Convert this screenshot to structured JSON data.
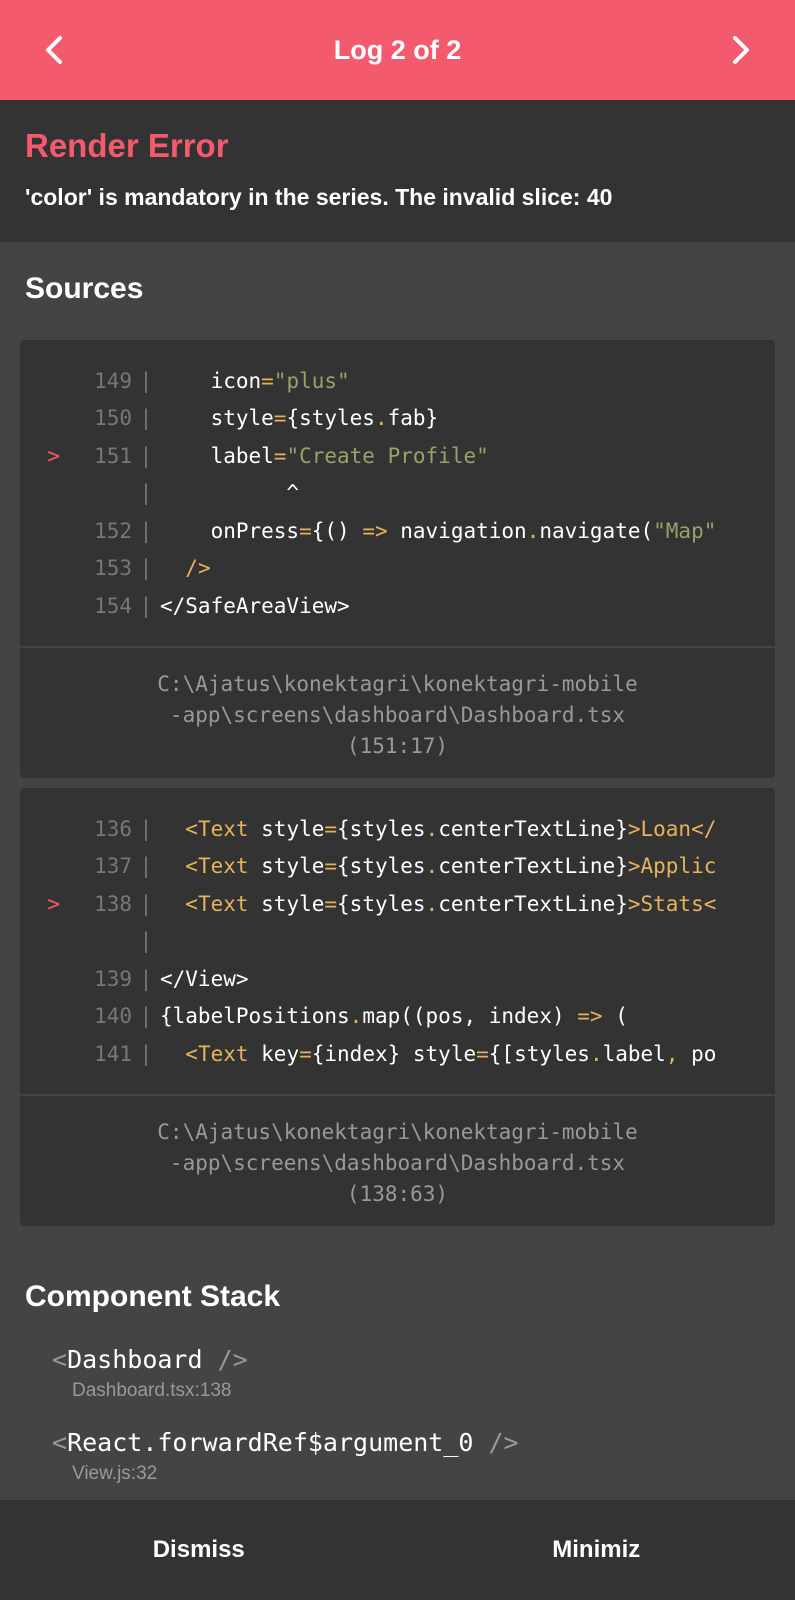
{
  "header": {
    "title": "Log 2 of 2"
  },
  "error": {
    "title": "Render Error",
    "message": "'color' is mandatory in the series. The invalid slice: 40"
  },
  "sources": {
    "title": "Sources",
    "frames": [
      {
        "file": "C:\\Ajatus\\konektagri\\konektagri-mobile",
        "file2": "-app\\screens\\dashboard\\Dashboard.tsx",
        "position": "(151:17)",
        "lines": [
          {
            "marker": "",
            "num": "149",
            "sep": "|"
          },
          {
            "marker": "",
            "num": "150",
            "sep": "|"
          },
          {
            "marker": ">",
            "num": "151",
            "sep": "|"
          },
          {
            "marker": "",
            "num": "",
            "sep": "|"
          },
          {
            "marker": "",
            "num": "152",
            "sep": "|"
          },
          {
            "marker": "",
            "num": "153",
            "sep": "|"
          },
          {
            "marker": "",
            "num": "154",
            "sep": "|"
          }
        ]
      },
      {
        "file": "C:\\Ajatus\\konektagri\\konektagri-mobile",
        "file2": "-app\\screens\\dashboard\\Dashboard.tsx",
        "position": "(138:63)",
        "lines": [
          {
            "marker": "",
            "num": "136",
            "sep": "|"
          },
          {
            "marker": "",
            "num": "137",
            "sep": "|"
          },
          {
            "marker": ">",
            "num": "138",
            "sep": "|"
          },
          {
            "marker": "",
            "num": "",
            "sep": "|"
          },
          {
            "marker": "",
            "num": "139",
            "sep": "|"
          },
          {
            "marker": "",
            "num": "140",
            "sep": "|"
          },
          {
            "marker": "",
            "num": "141",
            "sep": "|"
          }
        ]
      }
    ]
  },
  "code": {
    "f1l1": [
      "    icon",
      "=",
      "\"plus\""
    ],
    "f1l2": [
      "    style",
      "=",
      "{styles",
      ".",
      "fab}"
    ],
    "f1l3": [
      "    label",
      "=",
      "\"Create Profile\""
    ],
    "f1l4": [
      "          ^"
    ],
    "f1l5": [
      "    onPress",
      "=",
      "{() ",
      "=>",
      " navigation",
      ".",
      "navigate(",
      "\"Map\""
    ],
    "f1l6": [
      "  ",
      "/>"
    ],
    "f1l7": [
      "</SafeAreaView>"
    ],
    "f2l1": [
      "  ",
      "<Text",
      " style",
      "=",
      "{styles",
      ".",
      "centerTextLine}",
      ">Loan</"
    ],
    "f2l2": [
      "  ",
      "<Text",
      " style",
      "=",
      "{styles",
      ".",
      "centerTextLine}",
      ">Applic"
    ],
    "f2l3": [
      "  ",
      "<Text",
      " style",
      "=",
      "{styles",
      ".",
      "centerTextLine}",
      ">Stats<"
    ],
    "f2l4": [
      ""
    ],
    "f2l5": [
      "</View>"
    ],
    "f2l6": [
      "{labelPositions",
      ".",
      "map((pos, index) ",
      "=>",
      " ("
    ],
    "f2l7": [
      "  ",
      "<Text",
      " key",
      "=",
      "{index} style",
      "=",
      "{[styles",
      ".",
      "label",
      ",",
      " po"
    ]
  },
  "component_stack": {
    "title": "Component Stack",
    "items": [
      {
        "open": "<",
        "name": "Dashboard",
        "close": " />",
        "file": "Dashboard.tsx:138"
      },
      {
        "open": "<",
        "name": "React.forwardRef$argument_0",
        "close": " />",
        "file": "View.js:32"
      }
    ]
  },
  "footer": {
    "dismiss": "Dismiss",
    "minimize": "Minimiz"
  },
  "colors": {
    "accent": "#f45a6d",
    "panel": "#333333",
    "background": "#444444"
  }
}
